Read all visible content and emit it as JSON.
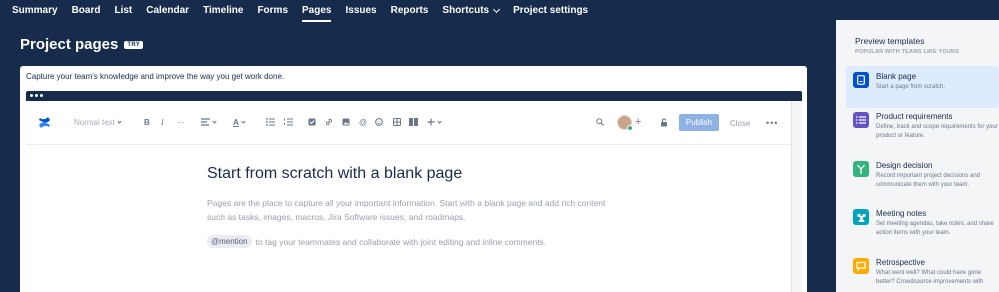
{
  "nav": {
    "items": [
      {
        "label": "Summary"
      },
      {
        "label": "Board"
      },
      {
        "label": "List"
      },
      {
        "label": "Calendar"
      },
      {
        "label": "Timeline"
      },
      {
        "label": "Forms"
      },
      {
        "label": "Pages",
        "active": true
      },
      {
        "label": "Issues"
      },
      {
        "label": "Reports"
      },
      {
        "label": "Shortcuts",
        "has_dropdown": true
      },
      {
        "label": "Project settings"
      }
    ]
  },
  "header": {
    "title": "Project pages",
    "badge": "TRY"
  },
  "card": {
    "intro": "Capture your team's knowledge and improve the way you get work done."
  },
  "editor": {
    "toolbar": {
      "text_style": "Normal text",
      "publish_label": "Publish",
      "close_label": "Close",
      "more_label": "•••"
    },
    "content": {
      "title": "Start from scratch with a blank page",
      "paragraph": "Pages are the place to capture all your important information. Start with a blank page and add rich content such as tasks, images, macros, Jira Software issues, and roadmaps.",
      "mention": "@mention",
      "mention_text": "to tag your teammates and collaborate with joint editing and inline comments."
    }
  },
  "panel": {
    "title": "Preview templates",
    "subtitle": "POPULAR WITH TEAMS LIKE YOURS",
    "templates": [
      {
        "title": "Blank page",
        "desc": "Start a page from scratch.",
        "color": "#0052cc",
        "icon": "page-icon",
        "selected": true
      },
      {
        "title": "Product requirements",
        "desc": "Define, track and scope requirements for your product or feature.",
        "color": "#6554c0",
        "icon": "list-icon"
      },
      {
        "title": "Design decision",
        "desc": "Record important project decisions and communicate them with your team.",
        "color": "#36b37e",
        "icon": "fork-icon"
      },
      {
        "title": "Meeting notes",
        "desc": "Set meeting agendas, take notes, and share action items with your team.",
        "color": "#00a3bf",
        "icon": "people-icon"
      },
      {
        "title": "Retrospective",
        "desc": "What went well? What could have gone better? Crowdsource improvements with",
        "color": "#ffab00",
        "icon": "chat-icon"
      }
    ]
  }
}
